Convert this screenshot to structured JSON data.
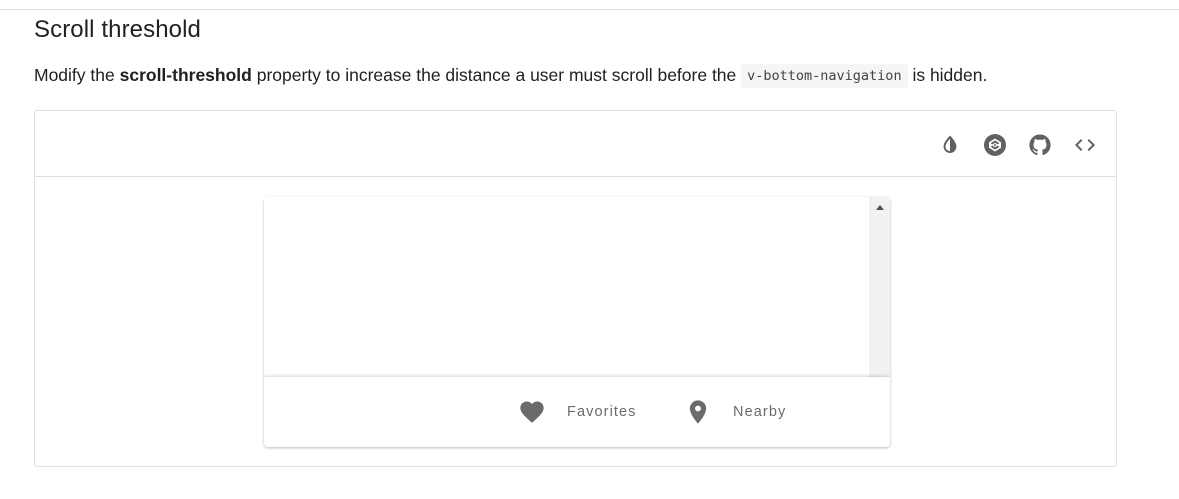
{
  "section": {
    "title": "Scroll threshold",
    "description_pre": "Modify the ",
    "description_bold": "scroll-threshold",
    "description_mid": " property to increase the distance a user must scroll before the ",
    "description_code": "v-bottom-navigation",
    "description_post": " is hidden."
  },
  "toolbar": {
    "buttons": [
      {
        "name": "invert-colors",
        "icon": "invert-colors-icon"
      },
      {
        "name": "codepen",
        "icon": "codepen-icon"
      },
      {
        "name": "github",
        "icon": "github-icon"
      },
      {
        "name": "view-source",
        "icon": "code-icon"
      }
    ]
  },
  "bottom_navigation": {
    "items": [
      {
        "label": "Favorites",
        "icon": "heart-icon"
      },
      {
        "label": "Nearby",
        "icon": "map-marker-icon"
      }
    ]
  },
  "colors": {
    "icon": "#616161",
    "nav_text": "#6b6b6b",
    "border": "#e0e0e0"
  }
}
